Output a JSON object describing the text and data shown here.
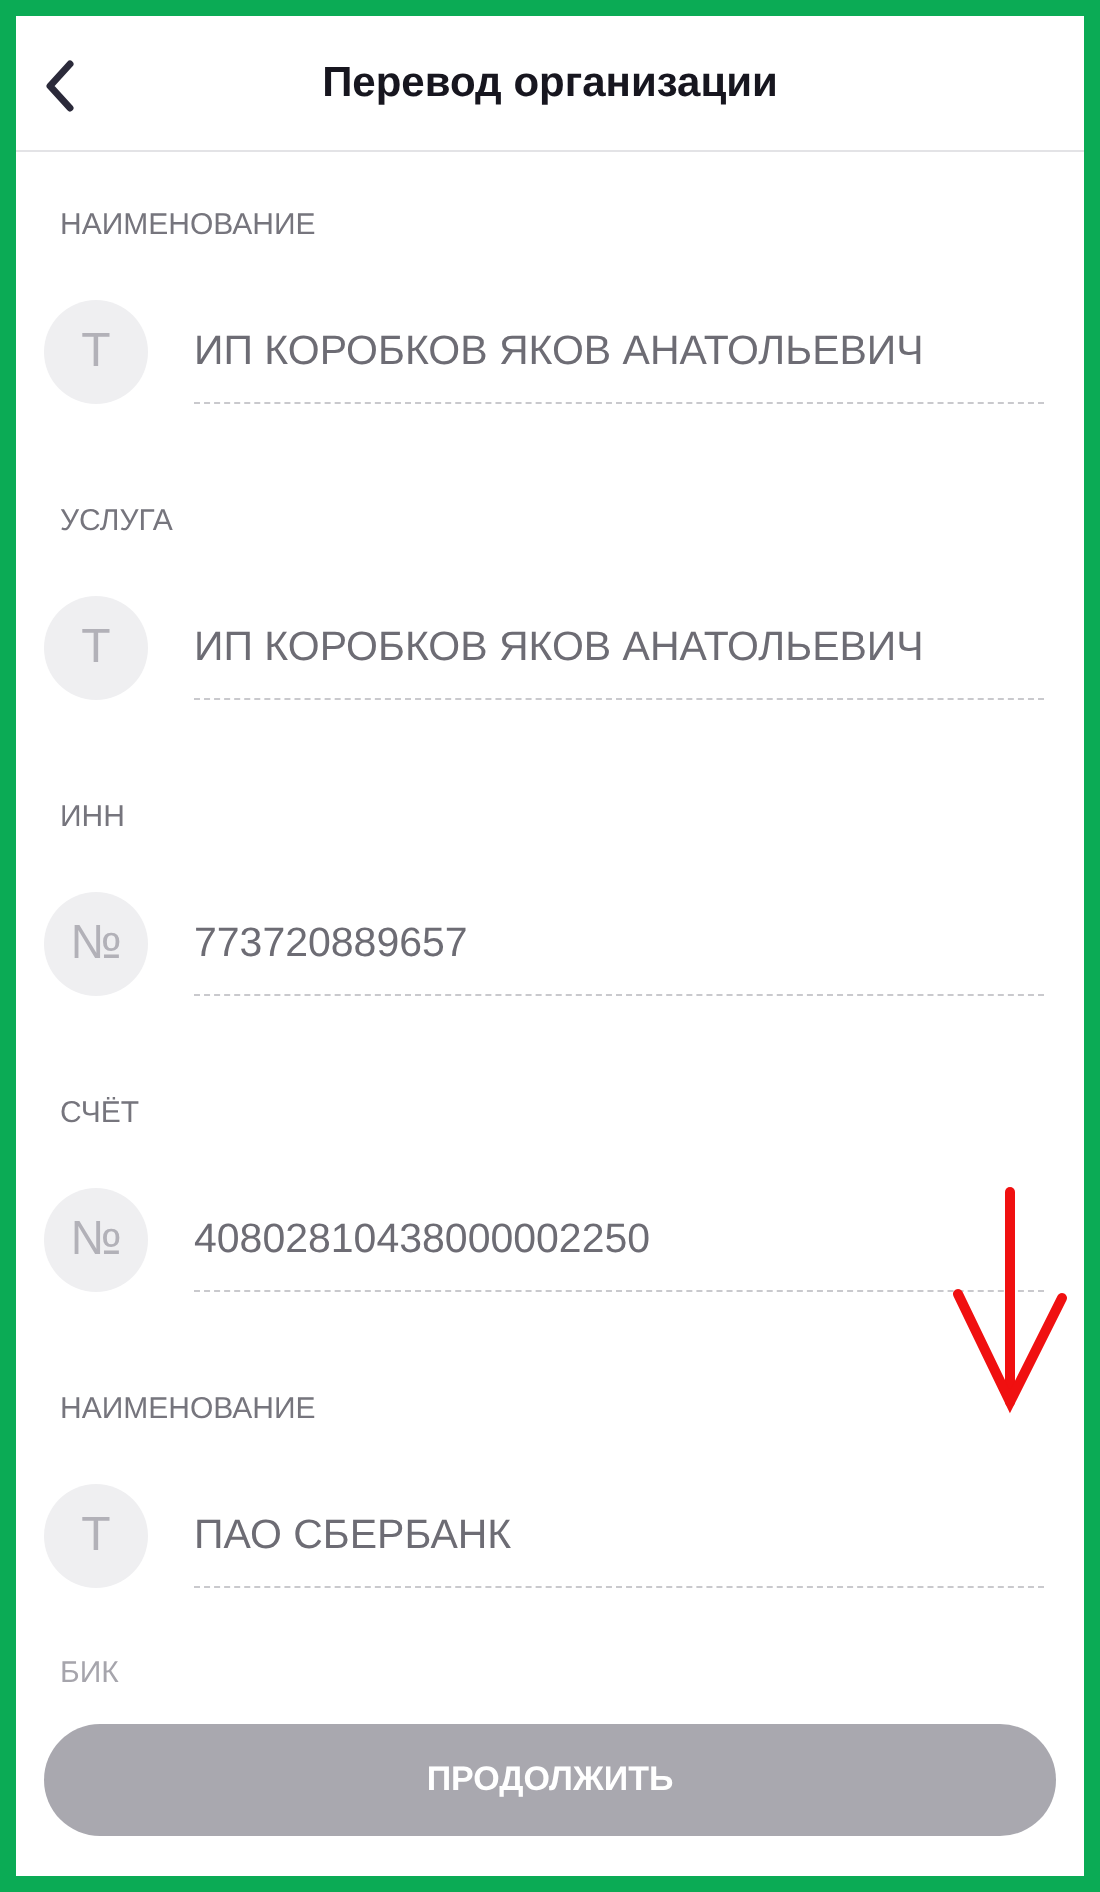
{
  "header": {
    "title": "Перевод организации"
  },
  "fields": [
    {
      "label": "НАИМЕНОВАНИЕ",
      "icon": "Т",
      "value": "ИП КОРОБКОВ ЯКОВ АНАТОЛЬЕВИЧ"
    },
    {
      "label": "УСЛУГА",
      "icon": "Т",
      "value": "ИП КОРОБКОВ ЯКОВ АНАТОЛЬЕВИЧ"
    },
    {
      "label": "ИНН",
      "icon": "№",
      "value": "773720889657"
    },
    {
      "label": "СЧЁТ",
      "icon": "№",
      "value": "40802810438000002250"
    },
    {
      "label": "НАИМЕНОВАНИЕ",
      "icon": "Т",
      "value": "ПАО СБЕРБАНК"
    }
  ],
  "partial_label": "БИК",
  "continue_button": {
    "label": "ПРОДОЛЖИТЬ",
    "disabled": true
  }
}
